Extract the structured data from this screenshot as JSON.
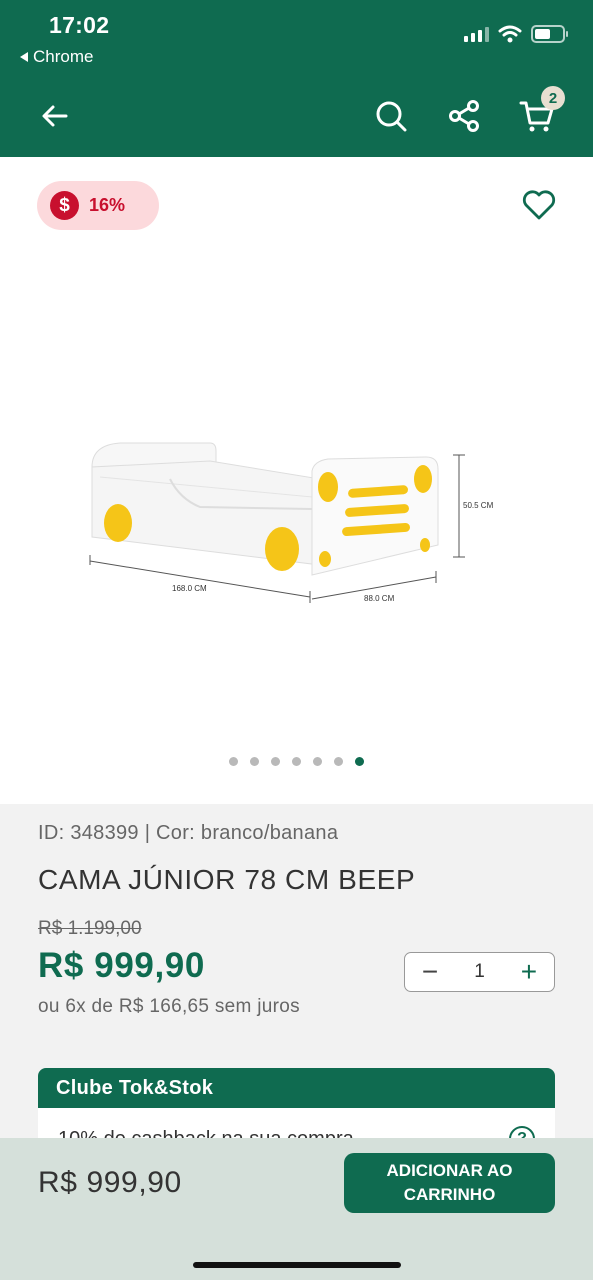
{
  "status_bar": {
    "time": "17:02",
    "back_app": "Chrome"
  },
  "header": {
    "cart_count": "2",
    "icons": [
      "back-arrow-icon",
      "search-icon",
      "share-icon",
      "cart-icon"
    ]
  },
  "gallery": {
    "discount_badge": {
      "symbol": "$",
      "percent": "16%"
    },
    "image_labels": {
      "length": "168.0 CM",
      "width": "88.0 CM",
      "height": "50.5 CM"
    },
    "total_images": 7,
    "active_index": 6
  },
  "product": {
    "meta": "ID: 348399 | Cor: branco/banana",
    "title": "CAMA JÚNIOR 78 CM BEEP",
    "old_price": "R$ 1.199,00",
    "price": "R$ 999,90",
    "installments": "ou 6x de R$ 166,65 sem juros",
    "quantity": "1"
  },
  "club": {
    "title": "Clube Tok&Stok",
    "text": "10% de cashback na sua compra",
    "help": "?"
  },
  "bottom_bar": {
    "price": "R$ 999,90",
    "add_button": "ADICIONAR AO CARRINHO"
  },
  "colors": {
    "brand_green": "#0f6b50",
    "discount_red": "#c8102e",
    "discount_bg": "#fcd9dc"
  }
}
